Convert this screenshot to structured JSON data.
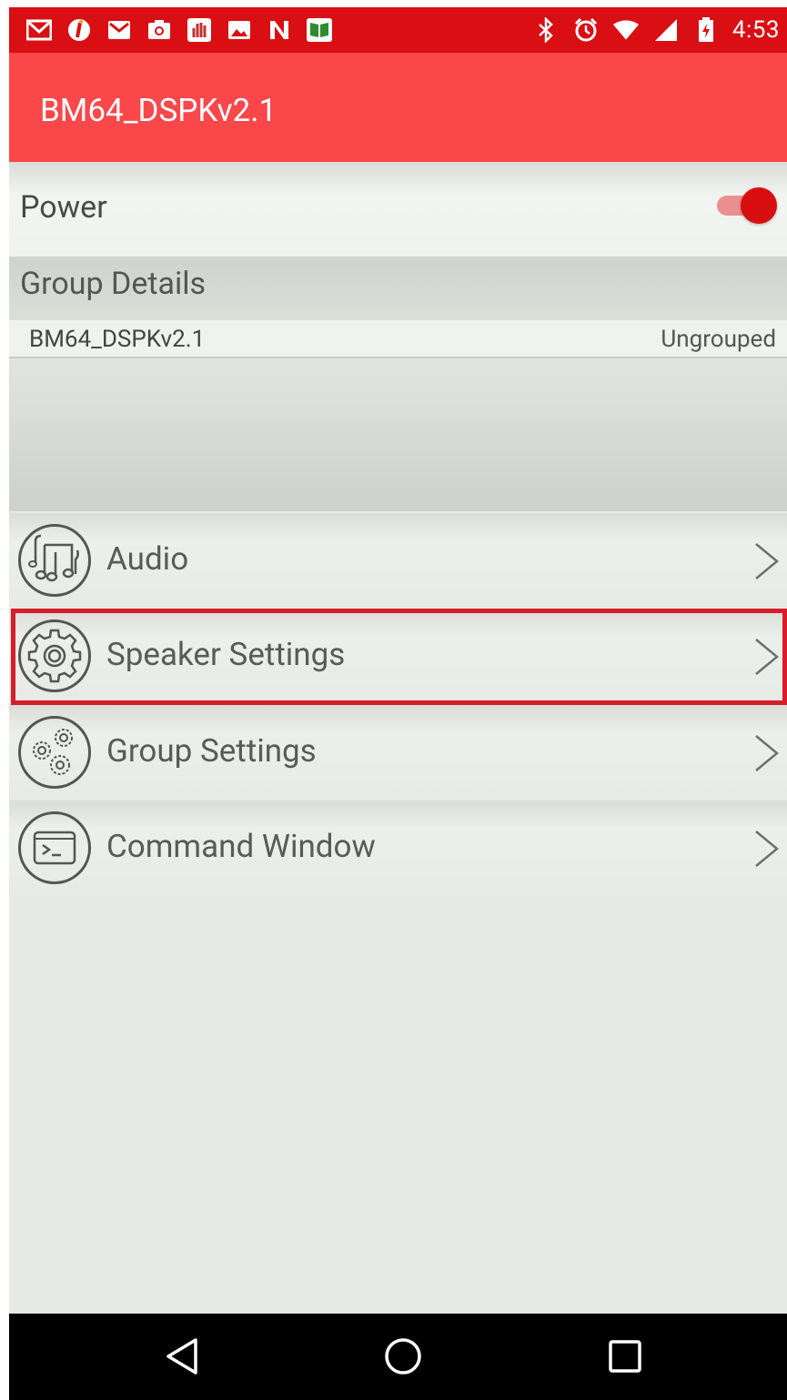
{
  "status_bar": {
    "time": "4:53",
    "left_icons": [
      "gmail-icon",
      "info-app-icon",
      "mail-icon",
      "camera-icon",
      "hand-app-icon",
      "image-icon",
      "news-icon",
      "book-app-icon"
    ],
    "right_icons": [
      "bluetooth-icon",
      "alarm-icon",
      "wifi-icon",
      "signal-icon",
      "battery-charging-icon"
    ]
  },
  "appbar": {
    "title": "BM64_DSPKv2.1"
  },
  "power": {
    "label": "Power",
    "enabled": true
  },
  "group_details": {
    "header": "Group Details",
    "device_name": "BM64_DSPKv2.1",
    "status": "Ungrouped"
  },
  "menu": [
    {
      "label": "Audio",
      "icon": "music-notes-icon"
    },
    {
      "label": "Speaker Settings",
      "icon": "gear-icon",
      "highlighted": true
    },
    {
      "label": "Group Settings",
      "icon": "gears-icon"
    },
    {
      "label": "Command Window",
      "icon": "terminal-icon"
    }
  ],
  "colors": {
    "status_bar": "#d90f13",
    "app_bar": "#f9474a",
    "switch_on": "#d90f0f",
    "highlight_border": "#d71d2a"
  }
}
